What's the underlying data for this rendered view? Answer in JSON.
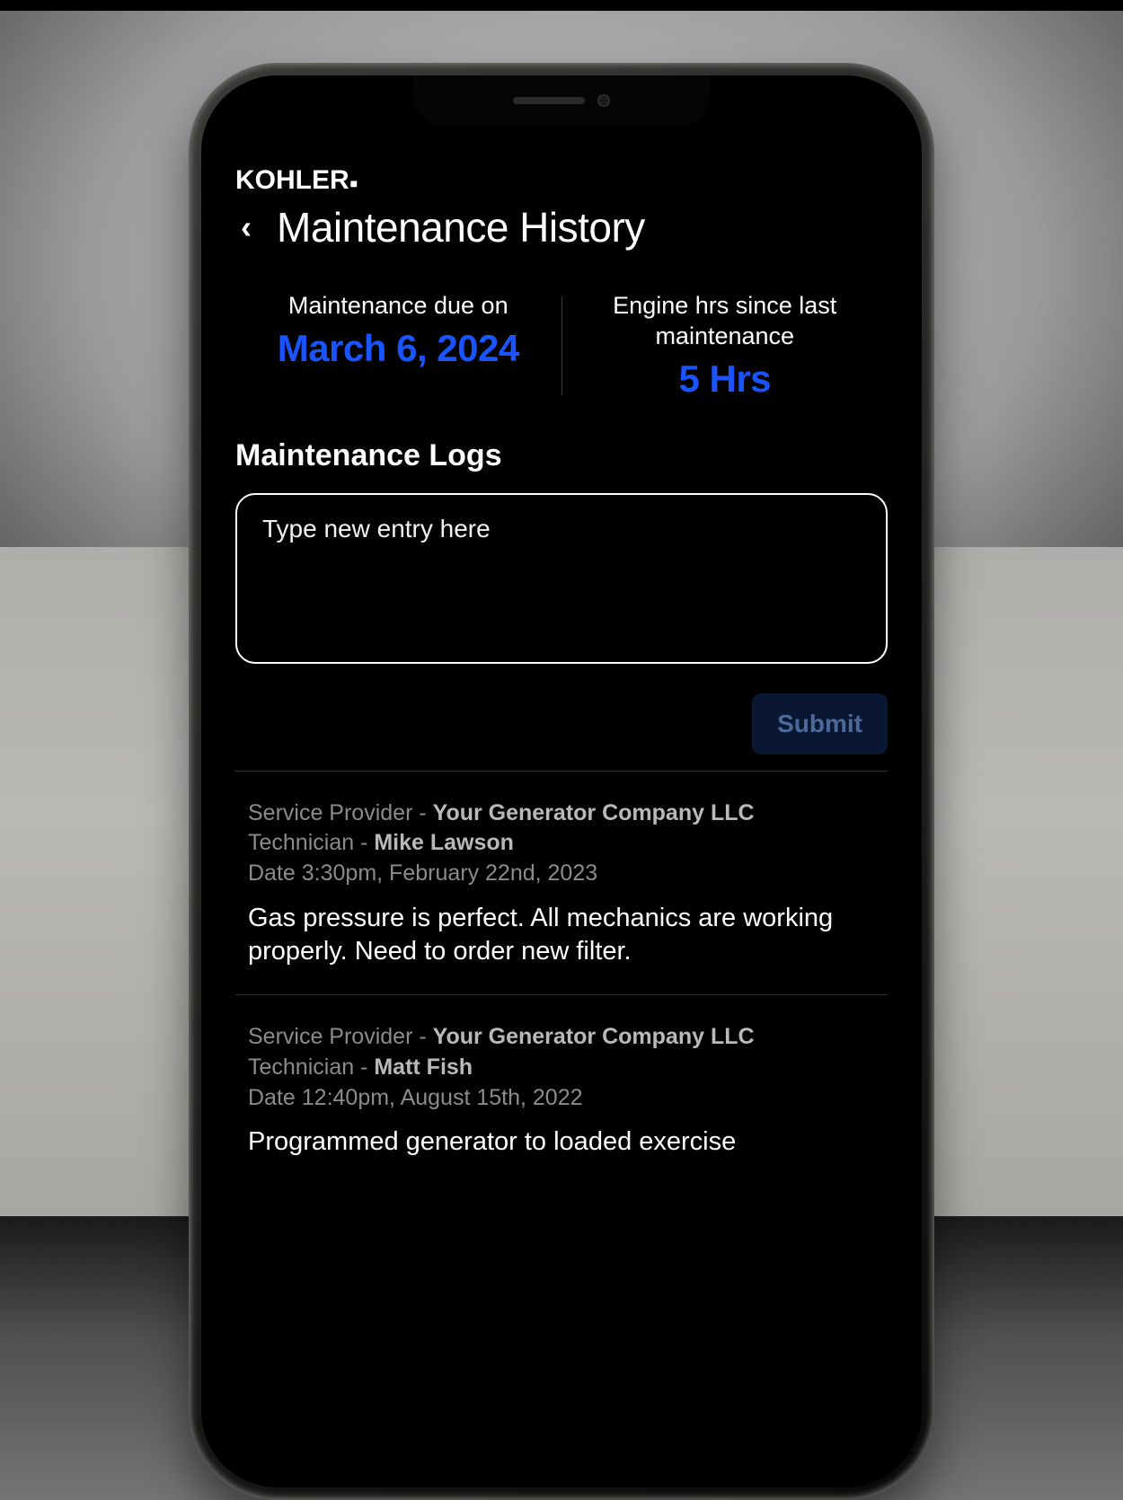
{
  "brand": "KOHLER",
  "header": {
    "back_glyph": "‹",
    "title": "Maintenance History"
  },
  "stats": {
    "due": {
      "label": "Maintenance due on",
      "value": "March 6, 2024"
    },
    "hours": {
      "label": "Engine hrs since last maintenance",
      "value": "5 Hrs"
    }
  },
  "logs_section_title": "Maintenance Logs",
  "entry_placeholder": "Type new entry here",
  "submit_label": "Submit",
  "field_labels": {
    "provider": "Service Provider - ",
    "technician": "Technician - ",
    "date_prefix": "Date "
  },
  "logs": [
    {
      "provider": "Your Generator Company LLC",
      "technician": "Mike Lawson",
      "date": "3:30pm, February 22nd, 2023",
      "body": "Gas pressure is perfect. All mechanics are working properly. Need to order new filter."
    },
    {
      "provider": "Your Generator Company LLC",
      "technician": "Matt Fish",
      "date": "12:40pm, August 15th, 2022",
      "body": "Programmed generator to loaded exercise"
    }
  ]
}
